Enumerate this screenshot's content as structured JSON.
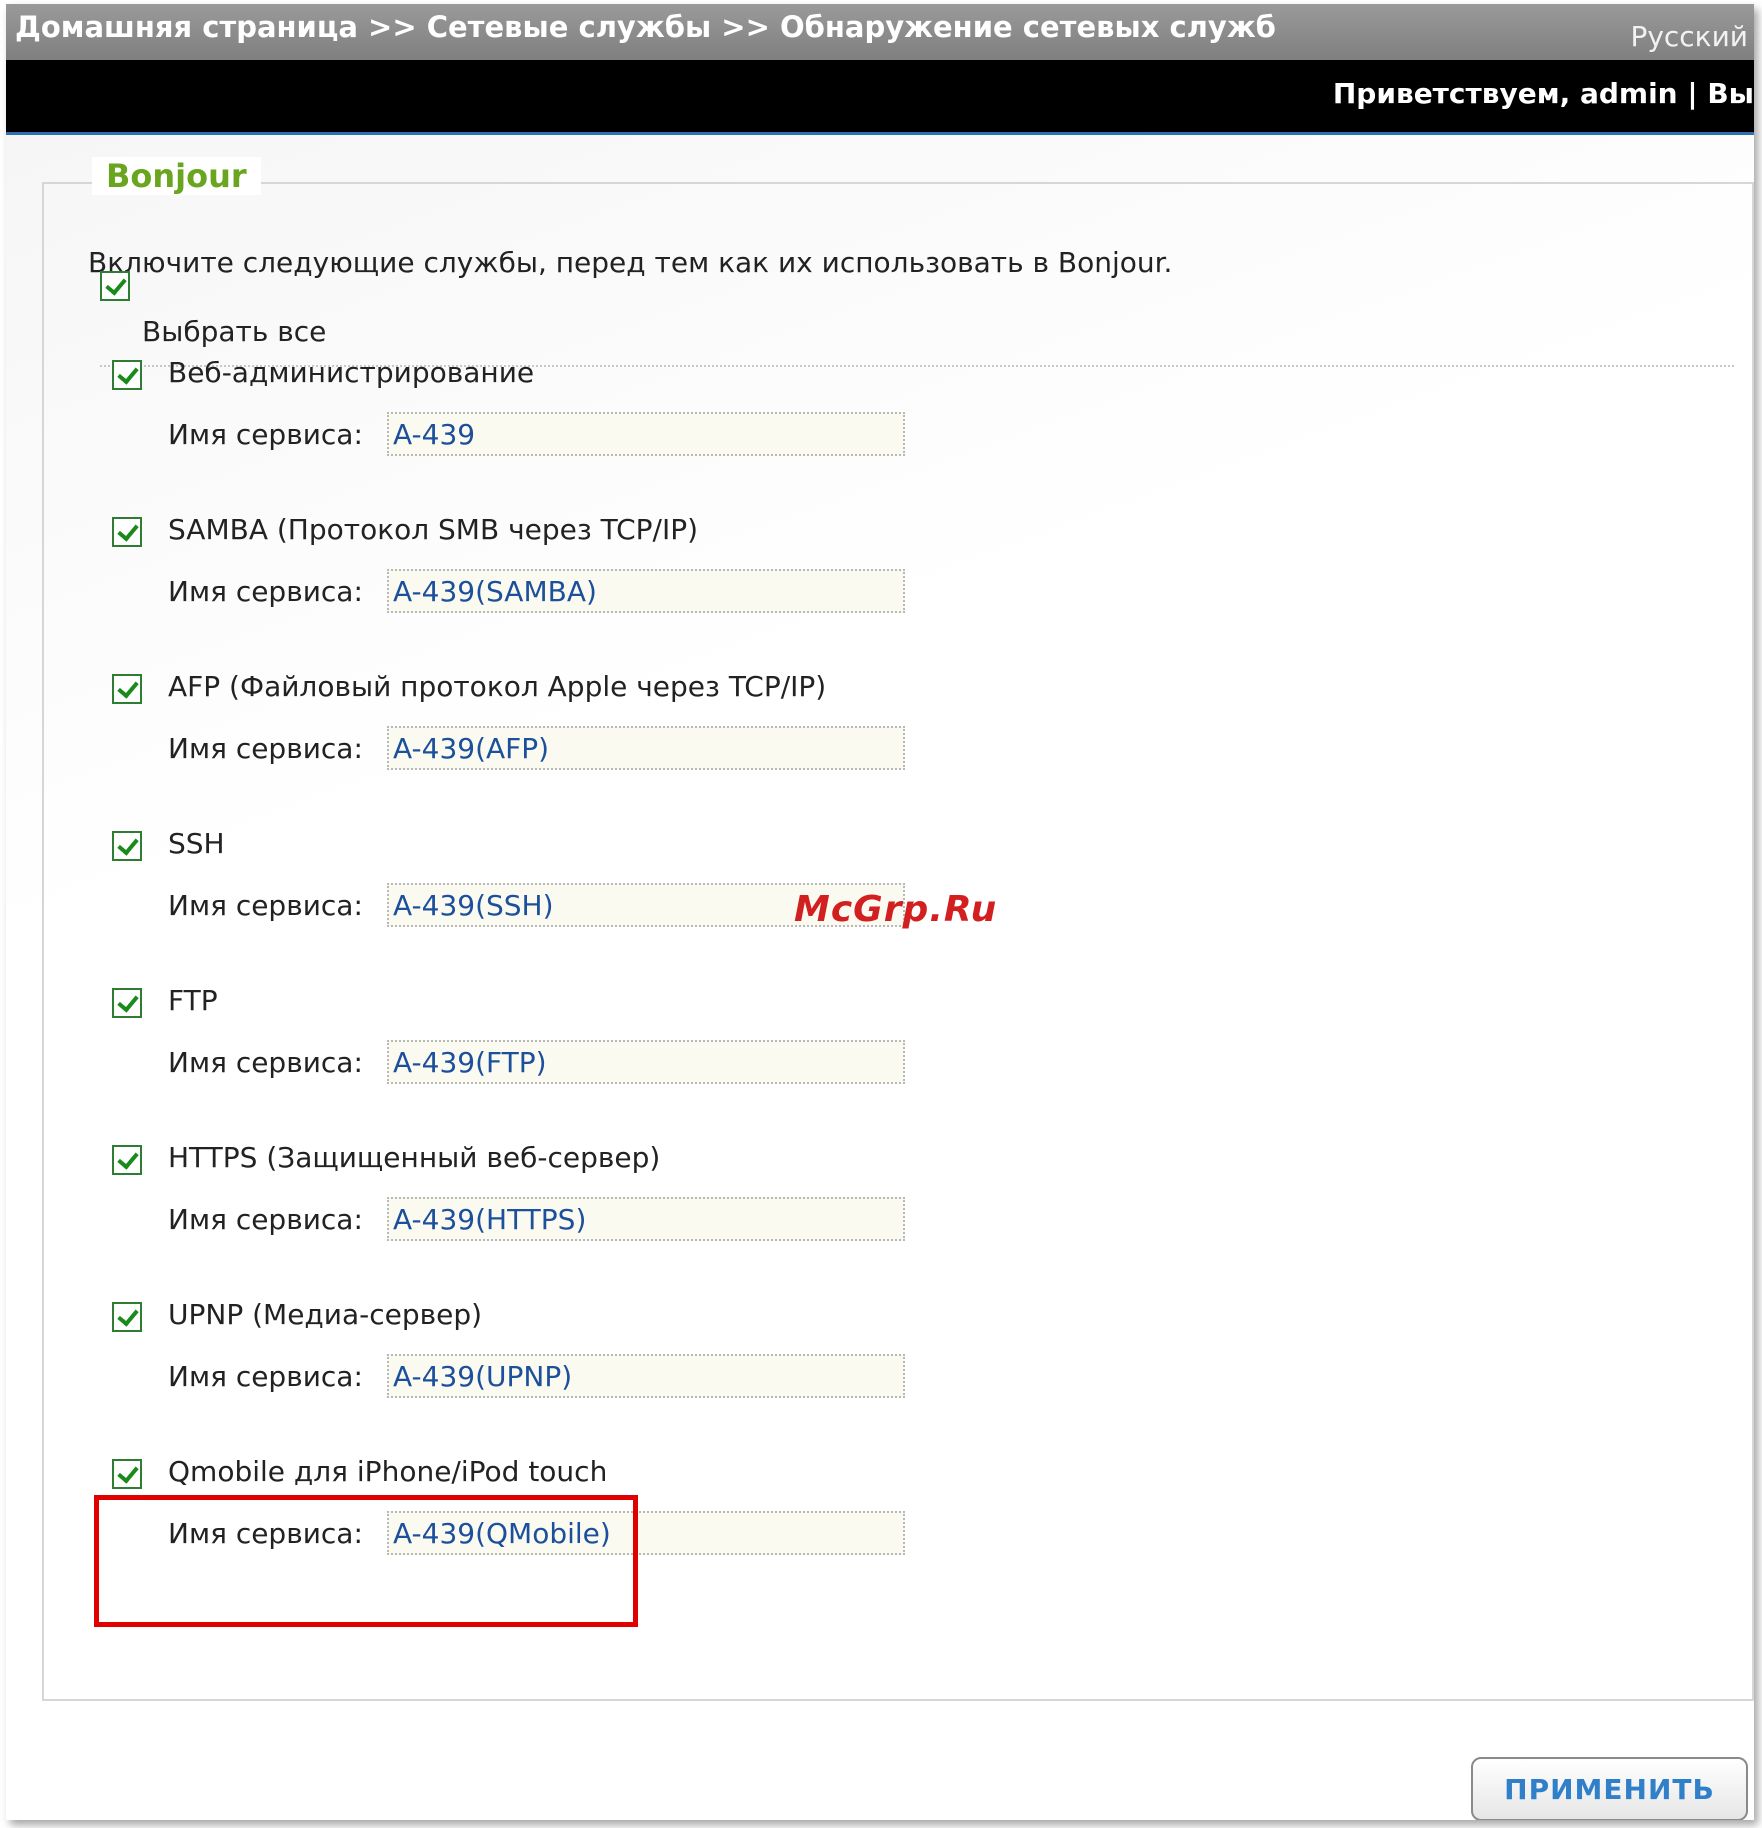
{
  "header": {
    "breadcrumb": "Домашняя страница >> Сетевые службы >> Обнаружение сетевых служб",
    "language": "Русский",
    "welcome": "Приветствуем, admin | Вы"
  },
  "section": {
    "legend": "Bonjour",
    "intro": "Включите следующие службы, перед тем как их использовать в Bonjour.",
    "select_all": {
      "label": "Выбрать все",
      "checked": true
    }
  },
  "services": [
    {
      "title": "Веб-администрирование",
      "name_label": "Имя сервиса:",
      "value": "A-439",
      "checked": true
    },
    {
      "title": "SAMBA (Протокол SMB через TCP/IP)",
      "name_label": "Имя сервиса:",
      "value": "A-439(SAMBA)",
      "checked": true
    },
    {
      "title": "AFP (Файловый протокол Apple через TCP/IP)",
      "name_label": "Имя сервиса:",
      "value": "A-439(AFP)",
      "checked": true
    },
    {
      "title": "SSH",
      "name_label": "Имя сервиса:",
      "value": "A-439(SSH)",
      "checked": true
    },
    {
      "title": "FTP",
      "name_label": "Имя сервиса:",
      "value": "A-439(FTP)",
      "checked": true
    },
    {
      "title": "HTTPS (Защищенный веб-сервер)",
      "name_label": "Имя сервиса:",
      "value": "A-439(HTTPS)",
      "checked": true
    },
    {
      "title": "UPNP (Медиа-сервер)",
      "name_label": "Имя сервиса:",
      "value": "A-439(UPNP)",
      "checked": true
    },
    {
      "title": "Qmobile для iPhone/iPod touch",
      "name_label": "Имя сервиса:",
      "value": "A-439(QMobile)",
      "checked": true
    }
  ],
  "watermark": "McGrp.Ru",
  "apply_label": "ПРИМЕНИТЬ",
  "colors": {
    "legend": "#6aa51f",
    "input_text": "#1c4f9c",
    "highlight": "#e00000",
    "apply_text": "#2f7fc9"
  }
}
